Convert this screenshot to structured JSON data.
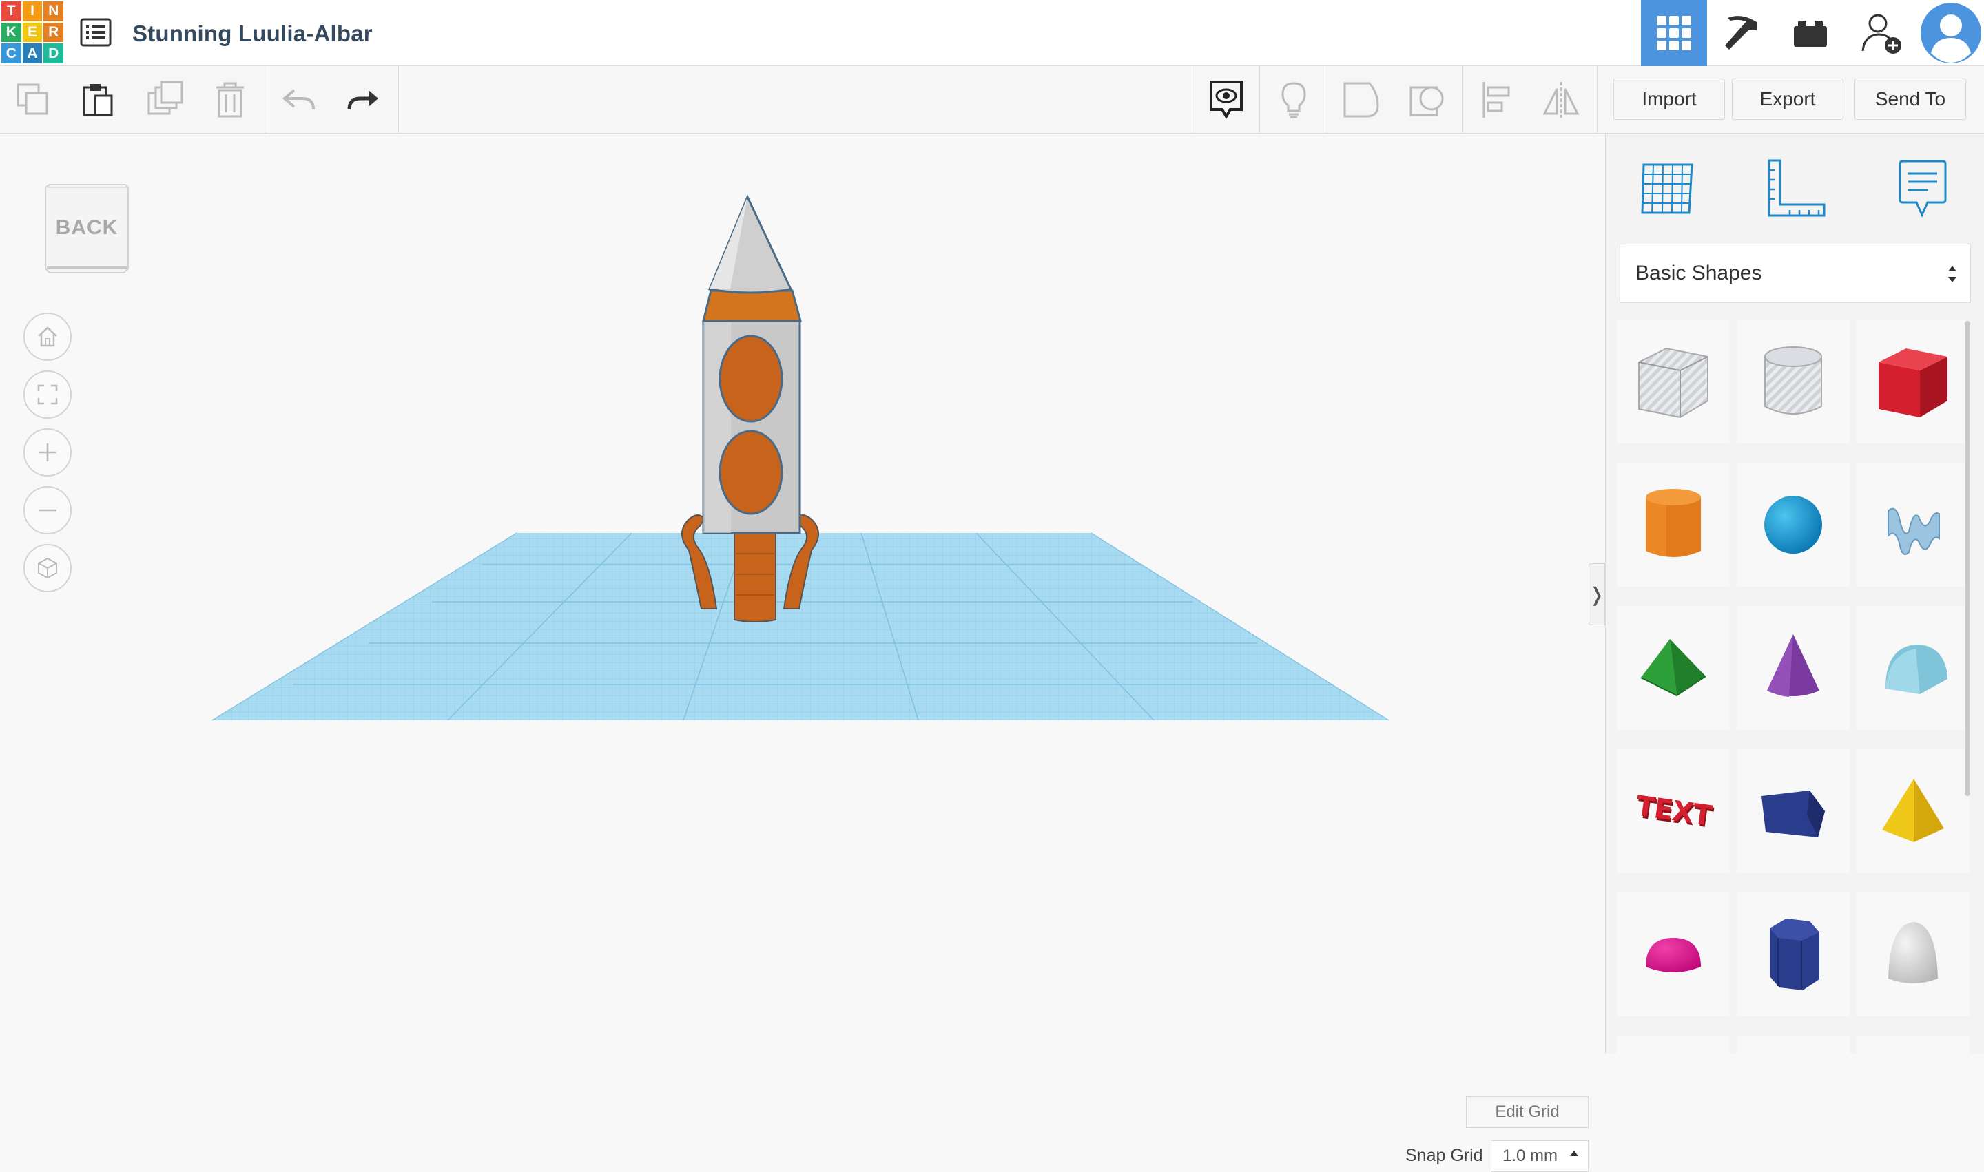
{
  "app": {
    "logo_letters": [
      "T",
      "I",
      "N",
      "K",
      "E",
      "R",
      "C",
      "A",
      "D"
    ],
    "logo_colors": [
      "#e74c3c",
      "#f39c12",
      "#e67e22",
      "#27ae60",
      "#f1c40f",
      "#e67e22",
      "#3498db",
      "#2980b9",
      "#1abc9c"
    ],
    "design_title": "Stunning Luulia-Albar"
  },
  "top_nav": {
    "items": [
      {
        "name": "3d-design-icon",
        "active": true
      },
      {
        "name": "pickaxe-icon",
        "active": false
      },
      {
        "name": "bricks-icon",
        "active": false
      },
      {
        "name": "invite-user-icon",
        "active": false
      },
      {
        "name": "user-avatar-icon",
        "active": false
      }
    ]
  },
  "toolbar": {
    "import_label": "Import",
    "export_label": "Export",
    "sendto_label": "Send To"
  },
  "viewcube": {
    "face_label": "BACK"
  },
  "canvas": {
    "edit_grid_label": "Edit Grid",
    "snap_grid_label": "Snap Grid",
    "snap_grid_value": "1.0 mm"
  },
  "sidebar": {
    "shape_category": "Basic Shapes",
    "shapes": [
      "box-hole-shape",
      "cylinder-hole-shape",
      "box-shape",
      "cylinder-shape",
      "sphere-shape",
      "scribble-shape",
      "roof-shape",
      "cone-shape",
      "round-roof-shape",
      "text-shape",
      "wedge-shape",
      "pyramid-shape",
      "half-sphere-shape",
      "polygon-shape",
      "paraboloid-shape"
    ],
    "text_shape_label": "TEXT"
  },
  "colors": {
    "accent": "#4c95de",
    "workplane": "#9fd6ee",
    "rocket_orange": "#c7631a",
    "rocket_grey": "#c8c8c8"
  }
}
